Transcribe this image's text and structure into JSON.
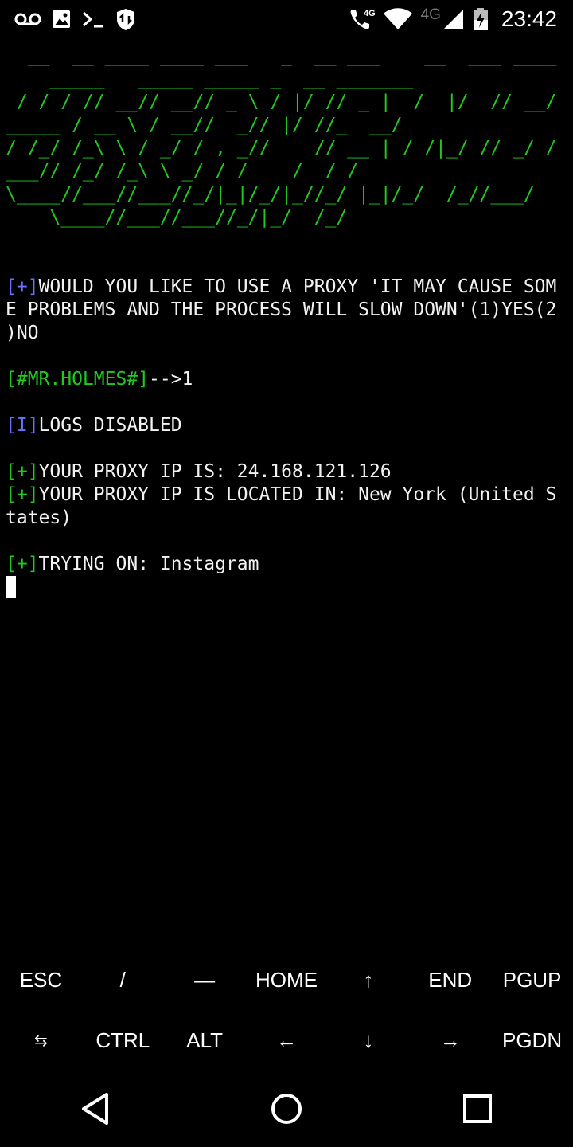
{
  "status_bar": {
    "time": "23:42",
    "network_label": "4G",
    "call_network_label": "4G",
    "left_icons": [
      "voicemail-icon",
      "image-icon",
      "terminal-icon",
      "data-saver-icon"
    ],
    "right_icons": [
      "wifi-calling-icon",
      "wifi-icon",
      "cell-signal-icon",
      "battery-charging-icon"
    ]
  },
  "terminal": {
    "banner": [
      "  __  __ ____ ____ ___   _  __ ___    __  ___ ____",
      "    _____   _____ _____ _  __ _______",
      " / / / // __// __// _ \\ / |/ // _ |  /  |/  // __/",
      "_____ / __ \\ / __//  _// |/ //_  __/",
      "/ /_/ /_\\ \\ / _/ / , _//    // __ | / /|_/ // _/ /",
      "___// /_/ /_\\ \\ _/ / /    /  / /",
      "\\____//___//___//_/|_|/_/|_//_/ |_|/_/  /_//___/",
      "    \\____//___//___//_/|_/  /_/"
    ],
    "proxy_prompt_tag": "[+]",
    "proxy_prompt_lines": [
      "WOULD YOU LIKE TO USE A PROXY 'IT MAY CAUSE SOM",
      "E PROBLEMS AND THE PROCESS WILL SLOW DOWN'(1)YES(2",
      ")NO"
    ],
    "input_tag": "[#MR.HOLMES#]",
    "input_value": "-->1",
    "logs_tag": "[I]",
    "logs_text": "LOGS DISABLED",
    "proxy_ip_tag": "[+]",
    "proxy_ip_text": "YOUR PROXY IP IS: 24.168.121.126",
    "proxy_loc_tag": "[+]",
    "proxy_loc_line1": "YOUR PROXY IP IS LOCATED IN: New York (United S",
    "proxy_loc_line2": "tates)",
    "trying_tag": "[+]",
    "trying_text": "TRYING ON: Instagram"
  },
  "extra_keys": {
    "row1": [
      "ESC",
      "/",
      "—",
      "HOME",
      "↑",
      "END",
      "PGUP"
    ],
    "row2": [
      "⇆",
      "CTRL",
      "ALT",
      "←",
      "↓",
      "→",
      "PGDN"
    ]
  },
  "nav_bar": {
    "buttons": [
      "back-icon",
      "home-icon",
      "recents-icon"
    ]
  },
  "colors": {
    "background": "#000000",
    "banner_green": "#22c81f",
    "tag_blue": "#6f6fff",
    "text": "#f2f2f2"
  }
}
